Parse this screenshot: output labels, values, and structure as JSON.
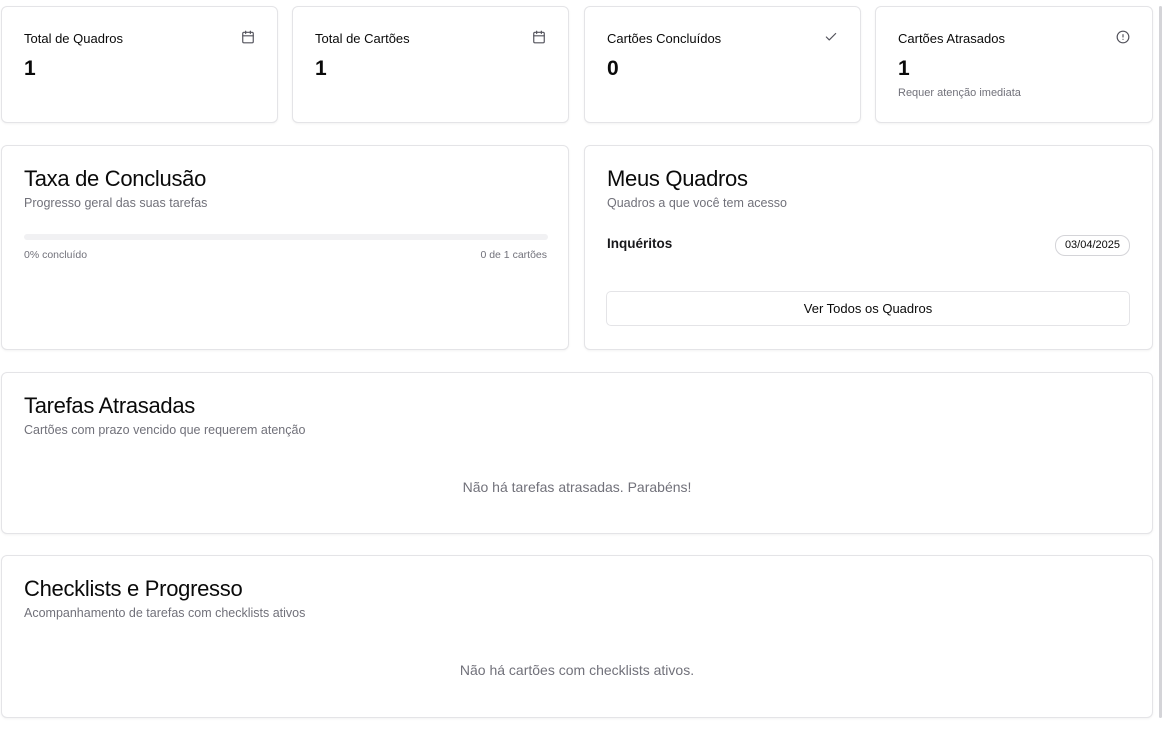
{
  "stats": [
    {
      "label": "Total de Quadros",
      "value": "1",
      "icon": "calendar-icon"
    },
    {
      "label": "Total de Cartões",
      "value": "1",
      "icon": "calendar-icon"
    },
    {
      "label": "Cartões Concluídos",
      "value": "0",
      "icon": "check-icon"
    },
    {
      "label": "Cartões Atrasados",
      "value": "1",
      "icon": "alert-circle-icon",
      "sub": "Requer atenção imediata"
    }
  ],
  "completion": {
    "title": "Taxa de Conclusão",
    "description": "Progresso geral das suas tarefas",
    "progress_percent": 0,
    "percent_label": "0% concluído",
    "count_label": "0 de 1 cartões"
  },
  "boards": {
    "title": "Meus Quadros",
    "description": "Quadros a que você tem acesso",
    "items": [
      {
        "name": "Inquéritos",
        "date": "03/04/2025"
      }
    ],
    "view_all_label": "Ver Todos os Quadros"
  },
  "overdue": {
    "title": "Tarefas Atrasadas",
    "description": "Cartões com prazo vencido que requerem atenção",
    "empty_message": "Não há tarefas atrasadas. Parabéns!"
  },
  "checklists": {
    "title": "Checklists e Progresso",
    "description": "Acompanhamento de tarefas com checklists ativos",
    "empty_message": "Não há cartões com checklists ativos."
  },
  "colors": {
    "text": "#0a0a0a",
    "muted": "#71717a",
    "border": "#e4e4e7",
    "progress_track": "#f1f1f3",
    "progress_fill": "#18181b"
  }
}
